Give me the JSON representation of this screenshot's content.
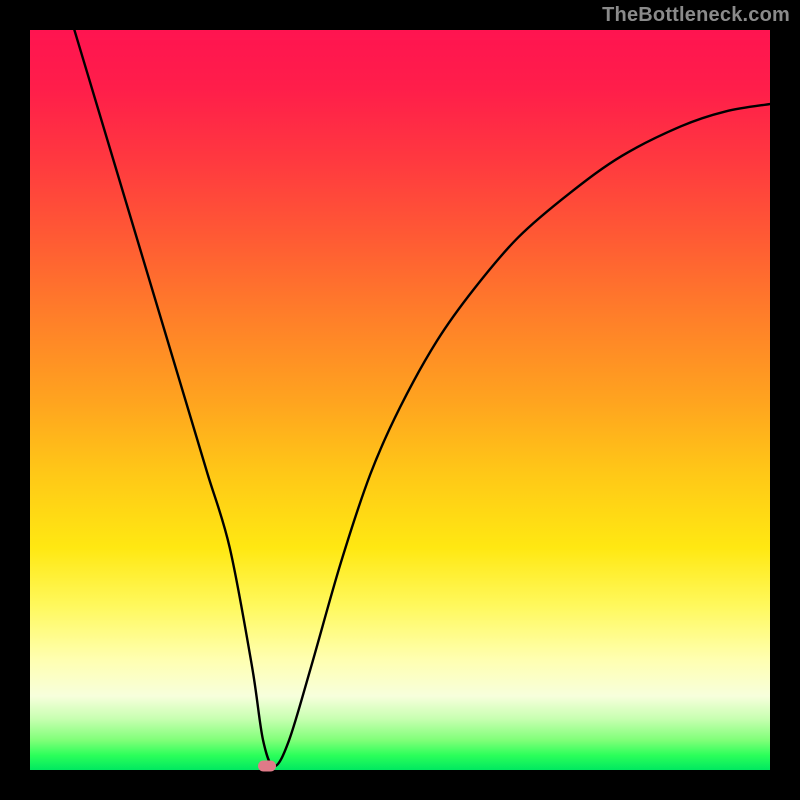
{
  "watermark": "TheBottleneck.com",
  "chart_data": {
    "type": "line",
    "title": "",
    "xlabel": "",
    "ylabel": "",
    "xlim": [
      0,
      100
    ],
    "ylim": [
      0,
      100
    ],
    "series": [
      {
        "name": "curve",
        "x": [
          6,
          9,
          12,
          15,
          18,
          21,
          24,
          27,
          30,
          31.5,
          33,
          35,
          38,
          42,
          46,
          50,
          55,
          60,
          66,
          73,
          80,
          88,
          94,
          100
        ],
        "y": [
          100,
          90,
          80,
          70,
          60,
          50,
          40,
          30,
          14,
          4,
          0.5,
          4,
          14,
          28,
          40,
          49,
          58,
          65,
          72,
          78,
          83,
          87,
          89,
          90
        ]
      }
    ],
    "marker": {
      "x": 32,
      "y": 0.5
    },
    "background": "rainbow-vertical-gradient"
  }
}
